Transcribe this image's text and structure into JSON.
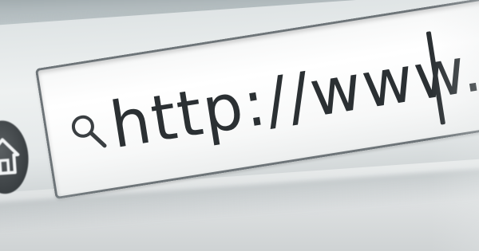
{
  "address_bar": {
    "url_text": "http://www.",
    "icon": "search-icon"
  },
  "toolbar": {
    "home_icon": "home-icon"
  },
  "colors": {
    "text": "#2b3033",
    "bar_border": "#6d7478",
    "home_button": "#3a3f42",
    "background": "#e3e7e8"
  }
}
